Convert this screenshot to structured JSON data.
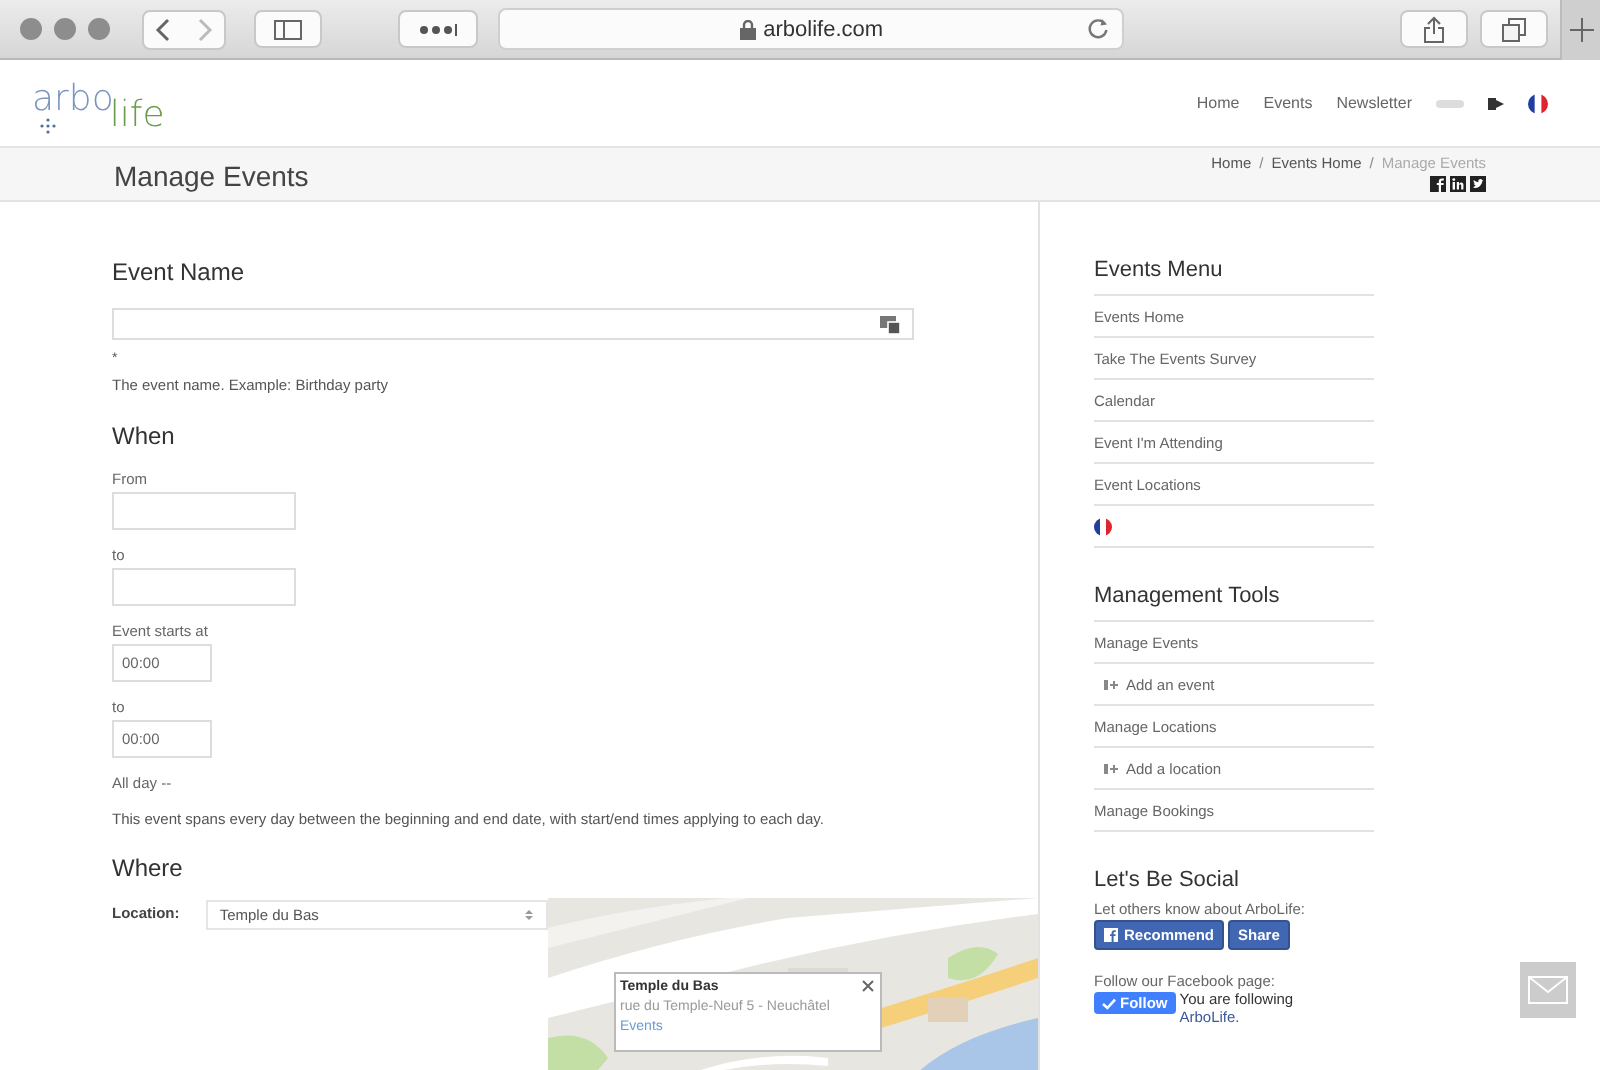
{
  "browser": {
    "url": "arbolife.com"
  },
  "header": {
    "logo": {
      "part_1": "arbo",
      "part_2": "life"
    },
    "nav_items": [
      "Home",
      "Events",
      "Newsletter"
    ]
  },
  "title_bar": {
    "title": "Manage Events",
    "breadcrumbs": [
      {
        "label": "Home",
        "current": false
      },
      {
        "label": "Events Home",
        "current": false
      },
      {
        "label": "Manage Events",
        "current": true
      }
    ],
    "separator": "/"
  },
  "event_name": {
    "heading": "Event Name",
    "required_mark": "*",
    "hint": "The event name. Example: Birthday party"
  },
  "when": {
    "heading": "When",
    "fields": [
      {
        "label": "From",
        "kind": "date"
      },
      {
        "label": "to",
        "kind": "date"
      },
      {
        "label": "Event starts at",
        "kind": "time",
        "value": "00:00"
      },
      {
        "label": "to",
        "kind": "time",
        "value": "00:00"
      }
    ],
    "all_day": "All day --",
    "note": "This event spans every day between the beginning and end date, with start/end times applying to each day."
  },
  "where": {
    "heading": "Where",
    "location_label": "Location:",
    "location_value": "Temple du Bas",
    "map": {
      "popup": {
        "title": "Temple du Bas",
        "address": "rue du Temple-Neuf 5 - Neuchâtel",
        "link": "Events"
      }
    }
  },
  "sidebar": {
    "sections": [
      {
        "heading": "Events Menu",
        "items": [
          {
            "label": "Events Home",
            "kind": "link"
          },
          {
            "label": "Take The Events Survey",
            "kind": "link"
          },
          {
            "label": "Calendar",
            "kind": "link"
          },
          {
            "label": "Event I'm Attending",
            "kind": "link"
          },
          {
            "label": "Event Locations",
            "kind": "link"
          },
          {
            "kind": "flag"
          }
        ]
      },
      {
        "heading": "Management Tools",
        "items": [
          {
            "label": "Manage Events",
            "kind": "link"
          },
          {
            "label": "Add an event",
            "kind": "sublink"
          },
          {
            "label": "Manage Locations",
            "kind": "link"
          },
          {
            "label": "Add a location",
            "kind": "sublink"
          },
          {
            "label": "Manage Bookings",
            "kind": "link"
          }
        ]
      }
    ],
    "social": {
      "heading": "Let's Be Social",
      "share_text": "Let others know about ArboLife:",
      "buttons": [
        "Recommend",
        "Share"
      ],
      "follow_text": "Follow our Facebook page:",
      "follow_button": "Follow",
      "following_text": "You are following",
      "following_link": "ArboLife."
    }
  }
}
